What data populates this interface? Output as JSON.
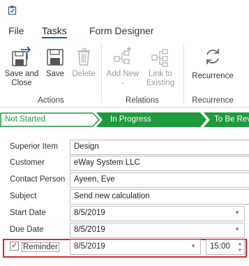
{
  "menu": {
    "tabs": [
      "File",
      "Tasks",
      "Form Designer"
    ],
    "active": "Tasks"
  },
  "ribbon": {
    "groups": [
      "Actions",
      "Relations",
      "Recurrence"
    ],
    "buttons": {
      "save_close": [
        "Save and",
        "Close"
      ],
      "save": "Save",
      "delete": "Delete",
      "add_new": "Add New",
      "link_existing": [
        "Link to",
        "Existing"
      ],
      "recurrence": "Recurrence"
    }
  },
  "stages": [
    "Not Started",
    "In Progress",
    "To Be Rev"
  ],
  "form": {
    "superior_item": {
      "label": "Superior Item",
      "value": "Design"
    },
    "customer": {
      "label": "Customer",
      "value": "eWay System LLC"
    },
    "contact_person": {
      "label": "Contact Person",
      "value": "Ayeen, Eve"
    },
    "subject": {
      "label": "Subject",
      "value": "Send new calculation"
    },
    "start_date": {
      "label": "Start Date",
      "value": "8/5/2019"
    },
    "due_date": {
      "label": "Due Date",
      "value": "8/5/2019"
    },
    "reminder": {
      "label": "Reminder",
      "checked": true,
      "date": "8/5/2019",
      "time": "15:00"
    }
  },
  "colors": {
    "accent": "#2b579a",
    "stage_green": "#1e9b3e",
    "highlight": "#d9272e"
  },
  "icons": [
    "clipboard-icon",
    "save-close-icon",
    "save-icon",
    "delete-icon",
    "add-new-icon",
    "link-existing-icon",
    "recurrence-icon",
    "checkmark-icon",
    "dropdown-arrow-icon",
    "spinner-arrows-icon"
  ]
}
